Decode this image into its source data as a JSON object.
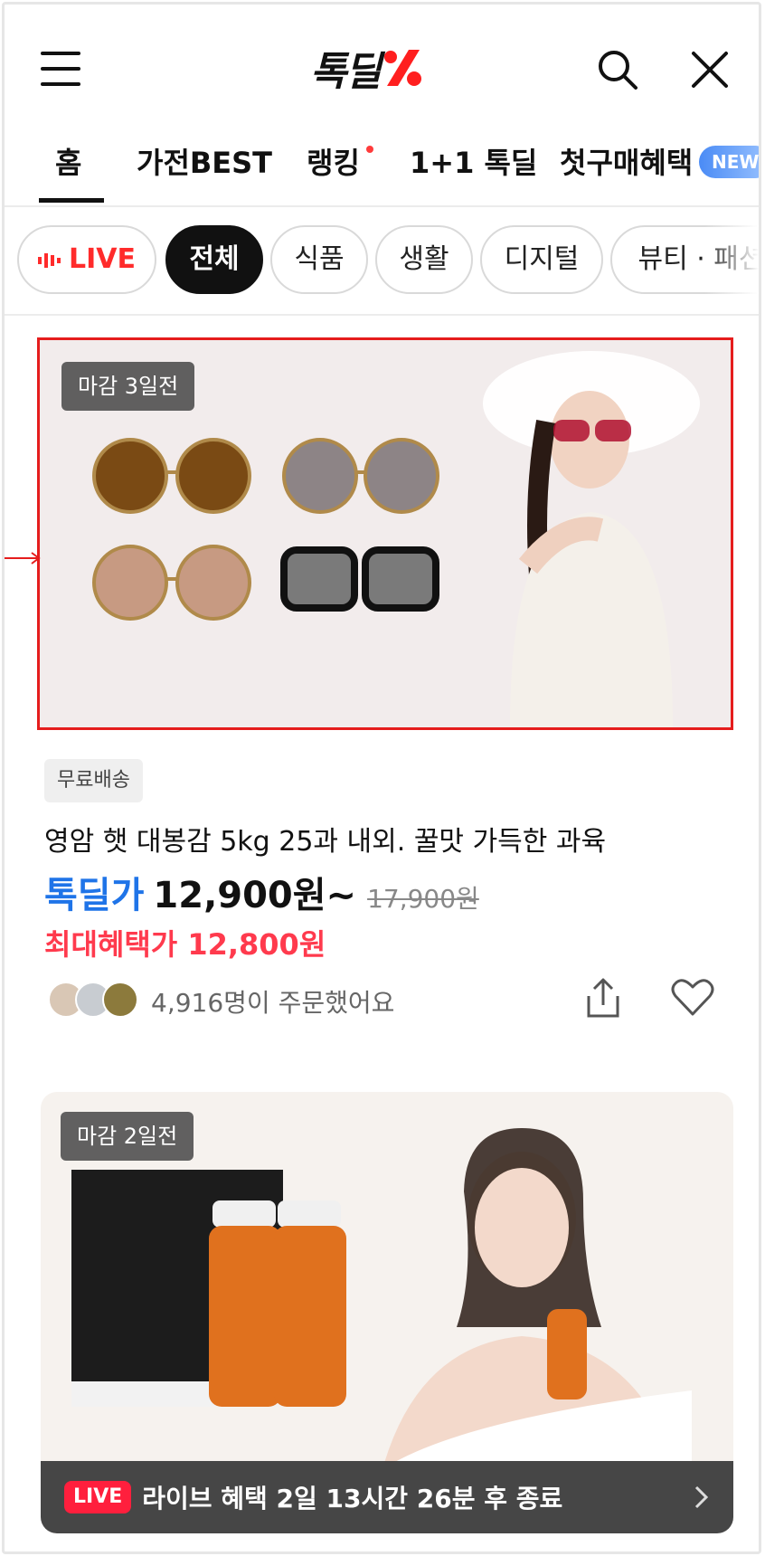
{
  "header": {
    "logo_text": "톡딜",
    "logo_accent_color": "#ff1f1f"
  },
  "tabs": [
    {
      "label": "홈",
      "active": true
    },
    {
      "label": "가전BEST"
    },
    {
      "label": "랭킹",
      "dot": true
    },
    {
      "label": "1+1 톡딜"
    },
    {
      "label": "첫구매혜택",
      "badge": "NEW"
    }
  ],
  "chips": [
    {
      "label": "LIVE",
      "type": "live"
    },
    {
      "label": "전체",
      "active": true
    },
    {
      "label": "식품"
    },
    {
      "label": "생활"
    },
    {
      "label": "디지털"
    },
    {
      "label": "뷰티 · 패션"
    }
  ],
  "products": [
    {
      "deadline": "마감 3일전",
      "badge": "무료배송",
      "title": "영암 햇 대봉감 5kg 25과 내외. 꿀맛 가득한 과육",
      "price_label": "톡딜가",
      "price": "12,900원~",
      "original_price": "17,900원",
      "max_benefit": "최대혜택가 12,800원",
      "orders": "4,916명이 주문했어요"
    },
    {
      "deadline": "마감 2일전",
      "live_badge": "LIVE",
      "live_text": "라이브 혜택 2일 13시간 26분 후 종료"
    }
  ],
  "colors": {
    "price_blue": "#1f74e8",
    "benefit_red": "#ff3a4d",
    "live_red": "#ff1f3d"
  }
}
